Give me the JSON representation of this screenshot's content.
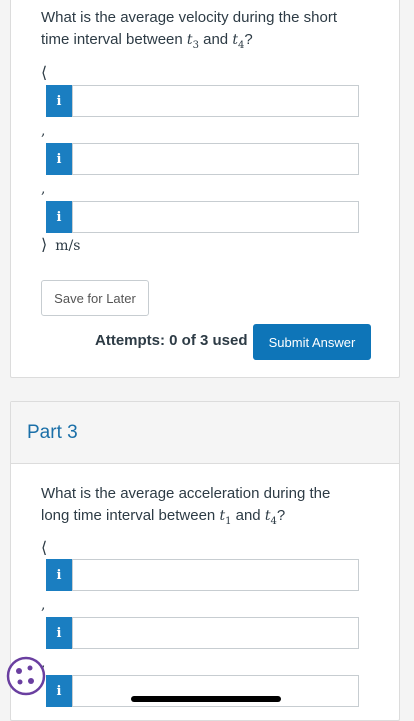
{
  "part2": {
    "question_prefix": "What is the average velocity during the short time interval between",
    "t_a": "t",
    "t_a_sub": "3",
    "and": "and",
    "t_b": "t",
    "t_b_sub": "4",
    "question_suffix": "?",
    "open_bracket": "⟨",
    "close_bracket": "⟩",
    "comma": ",",
    "unit": "m/s",
    "info_icon": "i",
    "save_label": "Save for Later",
    "attempts_label": "Attempts: 0 of 3 used",
    "submit_label": "Submit Answer"
  },
  "part3": {
    "title": "Part 3",
    "question_prefix": "What is the average acceleration during the long time interval between",
    "t_a": "t",
    "t_a_sub": "1",
    "and": "and",
    "t_b": "t",
    "t_b_sub": "4",
    "question_suffix": "?",
    "open_bracket": "⟨",
    "comma": ",",
    "info_icon": "i"
  },
  "colors": {
    "accent": "#0e75b8",
    "info_button": "#1a7ec1",
    "part_title": "#1a6fa8"
  }
}
